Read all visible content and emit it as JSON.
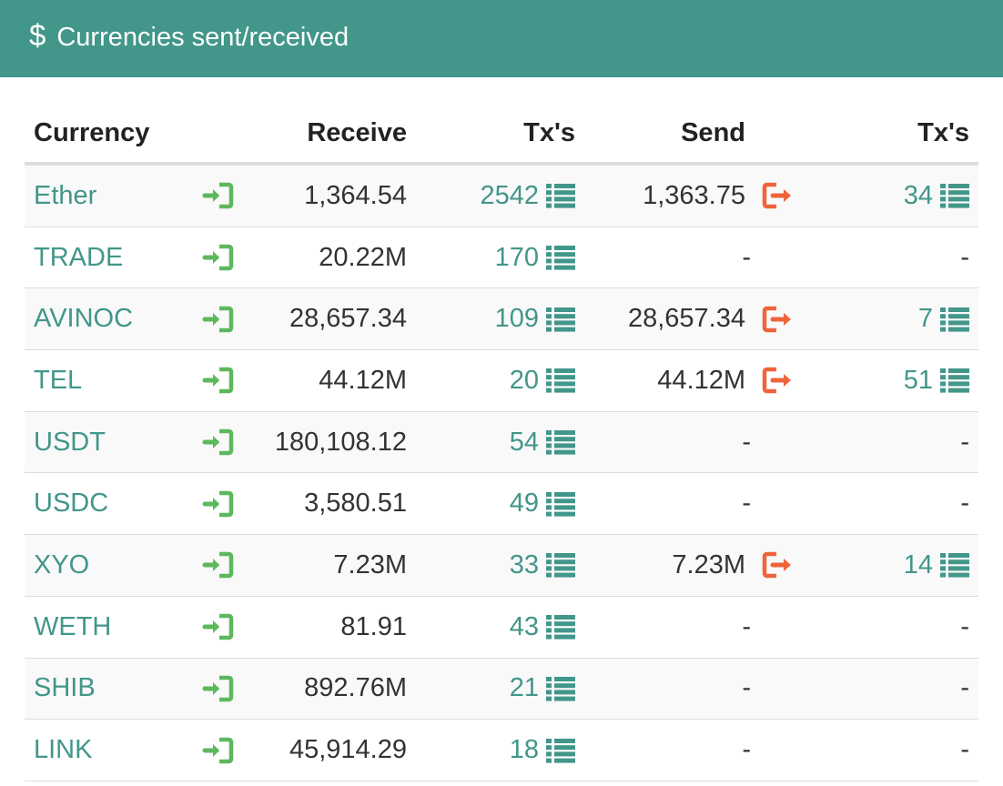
{
  "header": {
    "icon": "dollar-icon",
    "title": "Currencies sent/received",
    "background": "#42968a"
  },
  "columns": {
    "currency": "Currency",
    "receive": "Receive",
    "tx_receive": "Tx's",
    "send": "Send",
    "tx_send": "Tx's"
  },
  "colors": {
    "link": "#42968a",
    "receive_icon": "#5cb85c",
    "send_icon": "#f0643c"
  },
  "rows": [
    {
      "currency": "Ether",
      "receive": "1,364.54",
      "tx_receive": "2542",
      "send": "1,363.75",
      "tx_send": "34",
      "has_send": true
    },
    {
      "currency": "TRADE",
      "receive": "20.22M",
      "tx_receive": "170",
      "send": "-",
      "tx_send": "-",
      "has_send": false
    },
    {
      "currency": "AVINOC",
      "receive": "28,657.34",
      "tx_receive": "109",
      "send": "28,657.34",
      "tx_send": "7",
      "has_send": true
    },
    {
      "currency": "TEL",
      "receive": "44.12M",
      "tx_receive": "20",
      "send": "44.12M",
      "tx_send": "51",
      "has_send": true
    },
    {
      "currency": "USDT",
      "receive": "180,108.12",
      "tx_receive": "54",
      "send": "-",
      "tx_send": "-",
      "has_send": false
    },
    {
      "currency": "USDC",
      "receive": "3,580.51",
      "tx_receive": "49",
      "send": "-",
      "tx_send": "-",
      "has_send": false
    },
    {
      "currency": "XYO",
      "receive": "7.23M",
      "tx_receive": "33",
      "send": "7.23M",
      "tx_send": "14",
      "has_send": true
    },
    {
      "currency": "WETH",
      "receive": "81.91",
      "tx_receive": "43",
      "send": "-",
      "tx_send": "-",
      "has_send": false
    },
    {
      "currency": "SHIB",
      "receive": "892.76M",
      "tx_receive": "21",
      "send": "-",
      "tx_send": "-",
      "has_send": false
    },
    {
      "currency": "LINK",
      "receive": "45,914.29",
      "tx_receive": "18",
      "send": "-",
      "tx_send": "-",
      "has_send": false
    }
  ]
}
